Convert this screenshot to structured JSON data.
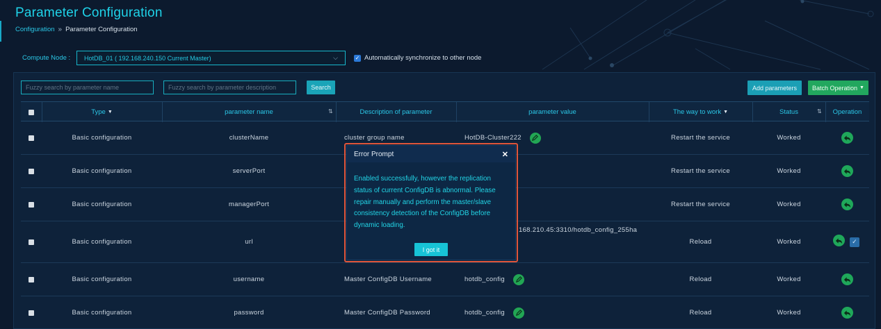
{
  "page": {
    "title": "Parameter Configuration",
    "breadcrumb": [
      "Configuration",
      "Parameter Configuration"
    ]
  },
  "node": {
    "label": "Compute Node :",
    "selected": "HotDB_01 ( 192.168.240.150 Current Master)",
    "sync_label": "Automatically synchronize to other node",
    "sync_checked": true
  },
  "toolbar": {
    "search_name_placeholder": "Fuzzy search by parameter name",
    "search_desc_placeholder": "Fuzzy search by parameter description",
    "search_label": "Search",
    "add_label": "Add parameters",
    "batch_label": "Batch Operation"
  },
  "table": {
    "headers": {
      "type": "Type",
      "name": "parameter name",
      "desc": "Description of parameter",
      "value": "parameter value",
      "way": "The way to work",
      "status": "Status",
      "operation": "Operation"
    },
    "rows": [
      {
        "type": "Basic configuration",
        "name": "clusterName",
        "desc": "cluster group name",
        "value": "HotDB-Cluster222",
        "way": "Restart the service",
        "status": "Worked"
      },
      {
        "type": "Basic configuration",
        "name": "serverPort",
        "desc": "",
        "value": "",
        "way": "Restart the service",
        "status": "Worked"
      },
      {
        "type": "Basic configuration",
        "name": "managerPort",
        "desc": "",
        "value": "",
        "way": "Restart the service",
        "status": "Worked"
      },
      {
        "type": "Basic configuration",
        "name": "url",
        "desc": "",
        "value": "168.210.45:3310/hotdb_config_255ha",
        "way": "Reload",
        "status": "Worked"
      },
      {
        "type": "Basic configuration",
        "name": "username",
        "desc": "Master ConfigDB Username",
        "value": "hotdb_config",
        "way": "Reload",
        "status": "Worked"
      },
      {
        "type": "Basic configuration",
        "name": "password",
        "desc": "Master ConfigDB Password",
        "value": "hotdb_config",
        "way": "Reload",
        "status": "Worked"
      }
    ]
  },
  "modal": {
    "title": "Error Prompt",
    "message": "Enabled successfully, however the replication status of current ConfigDB is abnormal. Please repair manually and perform the master/slave consistency detection of the ConfigDB before dynamic loading.",
    "button": "I got it"
  },
  "colors": {
    "background": "#0c1a2e",
    "accent": "#1fd2e8",
    "green": "#22a75e",
    "modal_border": "#e0553a"
  }
}
